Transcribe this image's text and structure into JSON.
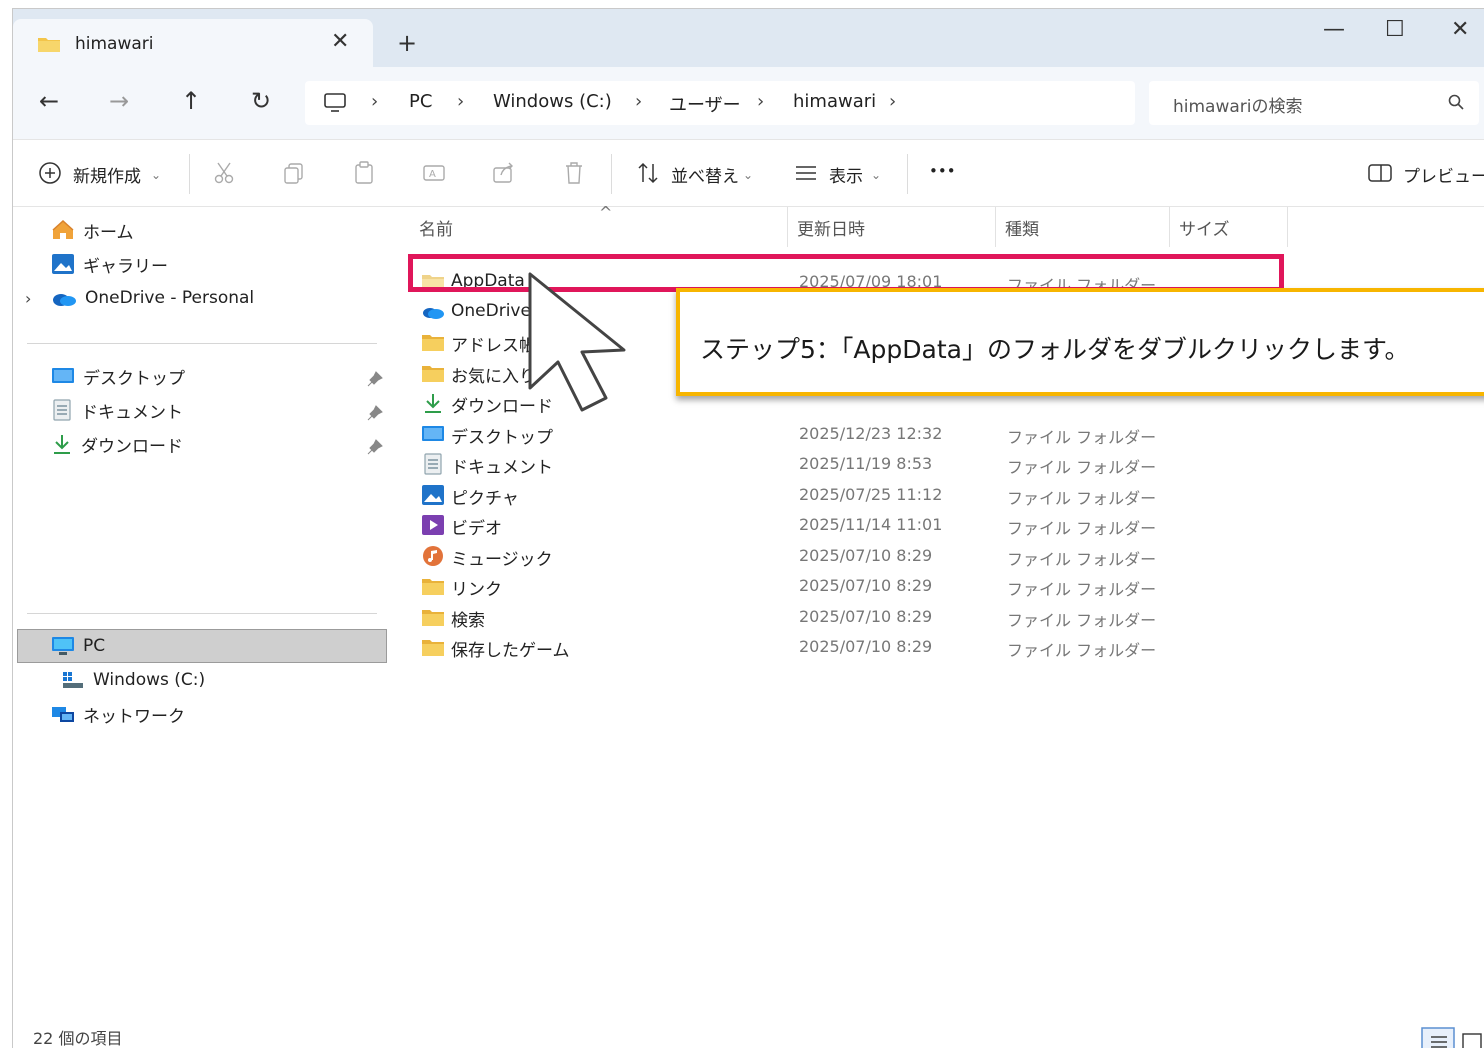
{
  "tab": {
    "title": "himawari",
    "close_glyph": "✕",
    "new_glyph": "+"
  },
  "window_controls": {
    "minimize": "—",
    "maximize": "☐",
    "close": "✕"
  },
  "nav": {
    "back": "←",
    "forward": "→",
    "up": "↑",
    "refresh": "↻"
  },
  "breadcrumb": [
    "PC",
    "Windows (C:)",
    "ユーザー",
    "himawari"
  ],
  "search": {
    "placeholder": "himawariの検索"
  },
  "commands": {
    "new": "新規作成",
    "sort": "並べ替え",
    "view": "表示",
    "more": "•••",
    "preview": "プレビュー"
  },
  "sidebar": {
    "quick": [
      {
        "label": "ホーム",
        "icon": "home-icon"
      },
      {
        "label": "ギャラリー",
        "icon": "gallery-icon"
      },
      {
        "label": "OneDrive - Personal",
        "icon": "onedrive-icon"
      }
    ],
    "pinned": [
      {
        "label": "デスクトップ",
        "icon": "desktop-icon"
      },
      {
        "label": "ドキュメント",
        "icon": "documents-icon"
      },
      {
        "label": "ダウンロード",
        "icon": "download-icon"
      }
    ],
    "devices": [
      {
        "label": "PC",
        "icon": "pc-icon"
      },
      {
        "label": "Windows (C:)",
        "icon": "drive-icon"
      },
      {
        "label": "ネットワーク",
        "icon": "network-icon"
      }
    ]
  },
  "columns": {
    "name": "名前",
    "date": "更新日時",
    "type": "種類",
    "size": "サイズ"
  },
  "files": [
    {
      "name": "AppData",
      "date": "2025/07/09 18:01",
      "type": "ファイル フォルダー",
      "icon": "folder-light-icon"
    },
    {
      "name": "OneDrive",
      "date": "",
      "type": "",
      "icon": "onedrive-icon"
    },
    {
      "name": "アドレス帳",
      "date": "",
      "type": "",
      "icon": "folder-icon"
    },
    {
      "name": "お気に入り",
      "date": "",
      "type": "",
      "icon": "folder-icon"
    },
    {
      "name": "ダウンロード",
      "date": "",
      "type": "",
      "icon": "download-icon"
    },
    {
      "name": "デスクトップ",
      "date": "2025/12/23 12:32",
      "type": "ファイル フォルダー",
      "icon": "desktop-icon"
    },
    {
      "name": "ドキュメント",
      "date": "2025/11/19 8:53",
      "type": "ファイル フォルダー",
      "icon": "documents-icon"
    },
    {
      "name": "ピクチャ",
      "date": "2025/07/25 11:12",
      "type": "ファイル フォルダー",
      "icon": "pictures-icon"
    },
    {
      "name": "ビデオ",
      "date": "2025/11/14 11:01",
      "type": "ファイル フォルダー",
      "icon": "videos-icon"
    },
    {
      "name": "ミュージック",
      "date": "2025/07/10 8:29",
      "type": "ファイル フォルダー",
      "icon": "music-icon"
    },
    {
      "name": "リンク",
      "date": "2025/07/10 8:29",
      "type": "ファイル フォルダー",
      "icon": "folder-icon"
    },
    {
      "name": "検索",
      "date": "2025/07/10 8:29",
      "type": "ファイル フォルダー",
      "icon": "folder-icon"
    },
    {
      "name": "保存したゲーム",
      "date": "2025/07/10 8:29",
      "type": "ファイル フォルダー",
      "icon": "folder-icon"
    }
  ],
  "callout": {
    "text": "ステップ5：「AppData」のフォルダをダブルクリックします。"
  },
  "status": {
    "item_count": "22 個の項目"
  },
  "colors": {
    "highlight": "#e0165a",
    "callout_border": "#f7b500",
    "folder": "#f3c54a",
    "accent": "#0067c0"
  }
}
